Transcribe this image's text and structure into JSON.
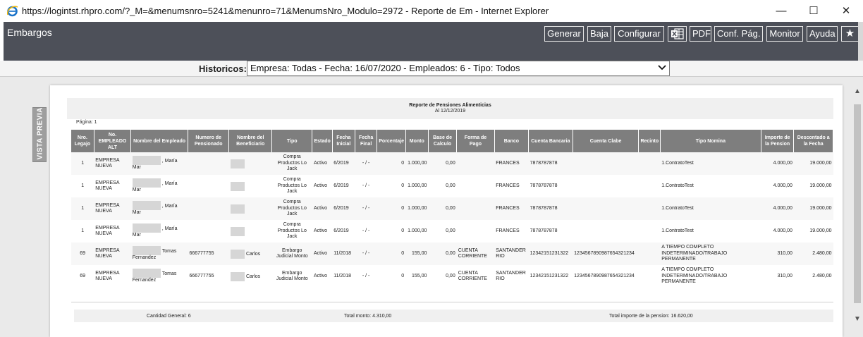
{
  "window": {
    "title": "https://logintst.rhpro.com/?_M=&menumsnro=5241&menunro=71&MenumsNro_Modulo=2972 - Reporte de Em - Internet Explorer",
    "min_glyph": "—",
    "max_glyph": "☐",
    "close_glyph": "✕"
  },
  "app": {
    "title": "Embargos"
  },
  "toolbar": {
    "generar": "Generar",
    "baja": "Baja",
    "configurar": "Configurar",
    "pdf": "PDF",
    "conf_pag": "Conf. Pág.",
    "monitor": "Monitor",
    "ayuda": "Ayuda",
    "excel_icon": "excel-icon",
    "star_icon": "star-icon"
  },
  "historicos": {
    "label": "Historicos:",
    "selected": "Empresa: Todas - Fecha: 16/07/2020 - Empleados: 6 - Tipo: Todos"
  },
  "vista_previa": "VISTA PREVIA",
  "report": {
    "title": "Reporte de Pensiones Alimenticias",
    "date": "Al 12/12/2019",
    "page": "Página: 1",
    "columns": [
      "Nro. Legajo",
      "No. EMPLEADO ALT",
      "Nombre del Empleado",
      "Numero de Pensionado",
      "Nombre del Beneficiario",
      "Tipo",
      "Estado",
      "Fecha Inicial",
      "Fecha Final",
      "Porcentaje",
      "Monto",
      "Base de Calculo",
      "Forma de Pago",
      "Banco",
      "Cuenta Bancaria",
      "Cuenta Clabe",
      "Recinto",
      "Tipo Nomina",
      "Importe de la Pension",
      "Descontado a la Fecha"
    ],
    "rows": [
      [
        "1",
        "EMPRESA NUEVA",
        ", María Mar",
        "",
        "",
        "Compra Productos Lo Jack",
        "Activo",
        "6/2019",
        "- / -",
        "0",
        "1.000,00",
        "0,00",
        "",
        "FRANCES",
        "7878787878",
        "",
        "",
        "1.ContratoTest",
        "4.000,00",
        "19.000,00"
      ],
      [
        "1",
        "EMPRESA NUEVA",
        ", María Mar",
        "",
        "",
        "Compra Productos Lo Jack",
        "Activo",
        "6/2019",
        "- / -",
        "0",
        "1.000,00",
        "0,00",
        "",
        "FRANCES",
        "7878787878",
        "",
        "",
        "1.ContratoTest",
        "4.000,00",
        "19.000,00"
      ],
      [
        "1",
        "EMPRESA NUEVA",
        ", María Mar",
        "",
        "",
        "Compra Productos Lo Jack",
        "Activo",
        "6/2019",
        "- / -",
        "0",
        "1.000,00",
        "0,00",
        "",
        "FRANCES",
        "7878787878",
        "",
        "",
        "1.ContratoTest",
        "4.000,00",
        "19.000,00"
      ],
      [
        "1",
        "EMPRESA NUEVA",
        ", María Mar",
        "",
        "",
        "Compra Productos Lo Jack",
        "Activo",
        "6/2019",
        "- / -",
        "0",
        "1.000,00",
        "0,00",
        "",
        "FRANCES",
        "7878787878",
        "",
        "",
        "1.ContratoTest",
        "4.000,00",
        "19.000,00"
      ],
      [
        "69",
        "EMPRESA NUEVA",
        "Tomas Fernandez",
        "666777755",
        "Carlos",
        "Embargo Judicial Monto",
        "Activo",
        "11/2018",
        "- / -",
        "0",
        "155,00",
        "0,00",
        "CUENTA CORRIENTE",
        "SANTANDER RIO",
        "12342151231322",
        "1234567890987654321234",
        "",
        "A TIEMPO COMPLETO INDETERMINADO/TRABAJO PERMANENTE",
        "310,00",
        "2.480,00"
      ],
      [
        "69",
        "EMPRESA NUEVA",
        "Tomas Fernandez",
        "666777755",
        "Carlos",
        "Embargo Judicial Monto",
        "Activo",
        "11/2018",
        "- / -",
        "0",
        "155,00",
        "0,00",
        "CUENTA CORRIENTE",
        "SANTANDER RIO",
        "12342151231322",
        "1234567890987654321234",
        "",
        "A TIEMPO COMPLETO INDETERMINADO/TRABAJO PERMANENTE",
        "310,00",
        "2.480,00"
      ]
    ],
    "footer": {
      "cantidad": "Cantidad General: 6",
      "total_monto": "Total monto: 4.310,00",
      "total_importe": "Total importe de la pension: 16.620,00"
    }
  }
}
